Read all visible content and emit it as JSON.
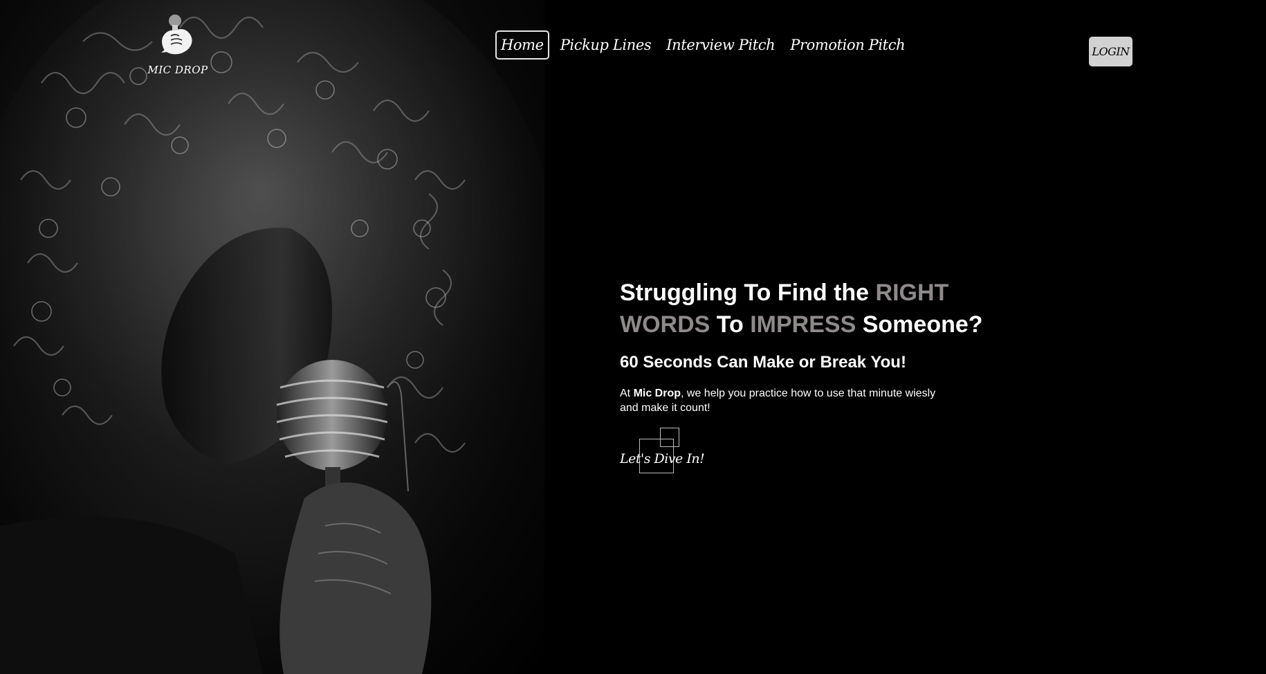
{
  "brand": {
    "name": "MIC DROP",
    "logo_icon": "microphone-fist-icon"
  },
  "nav": {
    "items": [
      {
        "label": "Home",
        "active": true
      },
      {
        "label": "Pickup Lines",
        "active": false
      },
      {
        "label": "Interview Pitch",
        "active": false
      },
      {
        "label": "Promotion Pitch",
        "active": false
      }
    ],
    "login_label": "LOGIN"
  },
  "hero": {
    "photo_icon": "singer-with-microphone-photo",
    "headline_part1": "Struggling To Find the ",
    "headline_accent1": "RIGHT WORDS",
    "headline_part2": " To ",
    "headline_accent2": "IMPRESS",
    "headline_part3": " Someone?",
    "subheadline": "60 Seconds Can Make or Break You!",
    "desc_prefix": "At ",
    "desc_brand": "Mic Drop",
    "desc_suffix": ", we help you practice how to use that minute wiesly and make it count!",
    "cta_label": "Let's Dive In!"
  },
  "colors": {
    "background": "#000000",
    "text": "#ffffff",
    "accent_muted": "#8f8a8a",
    "login_bg": "#d2d2d2"
  }
}
